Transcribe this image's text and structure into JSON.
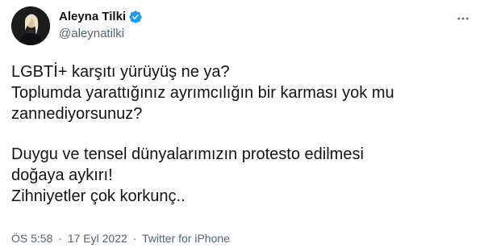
{
  "author": {
    "display_name": "Aleyna Tilki",
    "handle": "@aleynatilki",
    "verified_icon": "verified-badge-icon",
    "verified_color": "#1d9bf0"
  },
  "tweet": {
    "paragraph1": [
      "LGBTİ+ karşıtı yürüyüş ne ya?",
      "Toplumda yarattığınız ayrımcılığın bir karması yok mu",
      "zannediyorsunuz?"
    ],
    "paragraph2": [
      "Duygu ve tensel dünyalarımızın protesto edilmesi",
      "doğaya aykırı!",
      "Zihniyetler çok korkunç.."
    ]
  },
  "meta": {
    "time": "ÖS 5:58",
    "separator": "·",
    "date": "17 Eyl 2022",
    "source": "Twitter for iPhone"
  },
  "icons": {
    "more": "more-options-icon",
    "avatar": "avatar"
  },
  "colors": {
    "text_primary": "#0f1419",
    "text_secondary": "#536471",
    "verified": "#1d9bf0"
  }
}
